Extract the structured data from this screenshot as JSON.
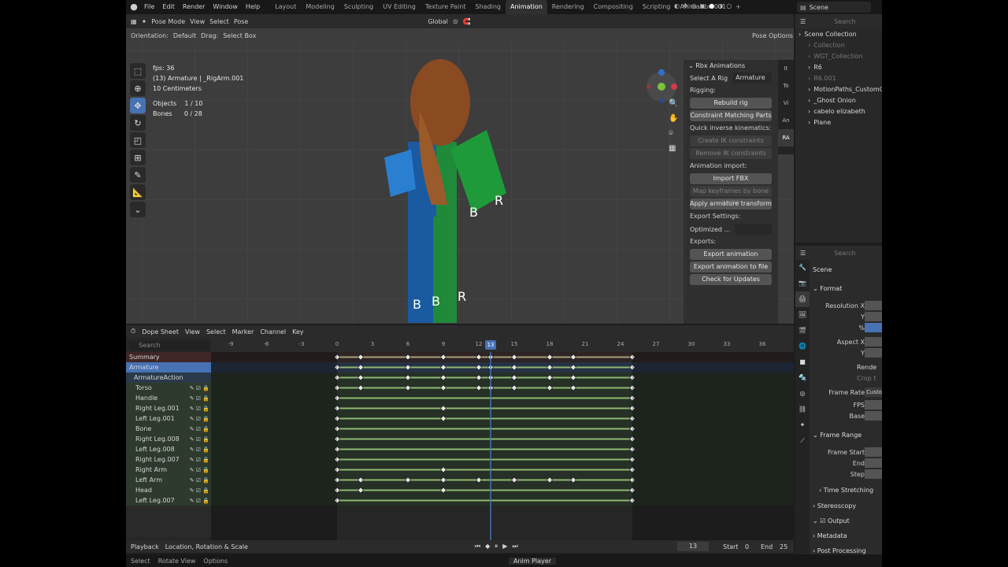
{
  "menu": {
    "items": [
      "File",
      "Edit",
      "Render",
      "Window",
      "Help"
    ]
  },
  "workspaces": [
    {
      "label": "Layout",
      "active": false
    },
    {
      "label": "Modeling",
      "active": false
    },
    {
      "label": "Sculpting",
      "active": false
    },
    {
      "label": "UV Editing",
      "active": false
    },
    {
      "label": "Texture Paint",
      "active": false
    },
    {
      "label": "Shading",
      "active": false
    },
    {
      "label": "Animation",
      "active": true
    },
    {
      "label": "Rendering",
      "active": false
    },
    {
      "label": "Compositing",
      "active": false
    },
    {
      "label": "Scripting",
      "active": false
    },
    {
      "label": "Animation.001",
      "active": false
    },
    {
      "label": "+",
      "active": false
    }
  ],
  "scene": {
    "name": "Scene"
  },
  "search_placeholder": "Search",
  "viewport": {
    "mode": "Pose Mode",
    "menu": [
      "View",
      "Select",
      "Pose"
    ],
    "transform": "Global",
    "orientation_label": "Orientation:",
    "orientation_value": "Default",
    "drag_label": "Drag:",
    "drag_value": "Select Box",
    "pose_options": "Pose Options",
    "info": {
      "fps": "fps: 36",
      "active": "(13) Armature | _RigArm.001",
      "units": "10 Centimeters",
      "objects_label": "Objects",
      "objects_value": "1 / 10",
      "bones_label": "Bones",
      "bones_value": "0 / 28"
    },
    "gizmo": {
      "x": "X",
      "y": "Y",
      "z": "Z"
    }
  },
  "rbx": {
    "title": "Rbx Animations",
    "select_rig_label": "Select A Rig",
    "select_rig_value": "Armature",
    "rigging_label": "Rigging:",
    "rebuild": "Rebuild rig",
    "constraint": "Constraint Matching Parts",
    "qik_label": "Quick inverse kinematics:",
    "create_ik": "Create IK constraints",
    "remove_ik": "Remove IK constraints",
    "import_label": "Animation import:",
    "import_fbx": "Import FBX",
    "map_keys": "Map keyframes by bone name",
    "apply_transform": "Apply armature transform",
    "export_settings_label": "Export Settings:",
    "optimized": "Optimized ...",
    "exports_label": "Exports:",
    "export_anim": "Export animation",
    "export_file": "Export animation to file",
    "check_updates": "Check for Updates",
    "tabs": [
      "It",
      "To",
      "Vi",
      "An",
      "RA"
    ]
  },
  "dope": {
    "mode": "Dope Sheet",
    "menu": [
      "View",
      "Select",
      "Marker",
      "Channel",
      "Key"
    ],
    "search_placeholder": "Search",
    "ruler": [
      -9,
      -6,
      -3,
      0,
      3,
      6,
      9,
      12,
      15,
      18,
      21,
      24,
      27,
      30,
      33,
      36
    ],
    "current_frame": 13,
    "channels": [
      {
        "name": "Summary",
        "type": "summary",
        "keys": [
          0,
          2,
          6,
          9,
          12,
          13,
          15,
          18,
          20,
          25
        ]
      },
      {
        "name": "Armature",
        "type": "object",
        "keys": [
          0,
          2,
          6,
          9,
          12,
          13,
          15,
          18,
          20,
          25
        ]
      },
      {
        "name": "ArmatureAction",
        "type": "action",
        "keys": [
          0,
          2,
          6,
          9,
          12,
          13,
          15,
          18,
          20,
          25
        ]
      },
      {
        "name": "Torso",
        "type": "bone",
        "keys": [
          0,
          2,
          6,
          9,
          12,
          13,
          15,
          18,
          20,
          25
        ]
      },
      {
        "name": "Handle",
        "type": "bone",
        "keys": [
          0,
          25
        ]
      },
      {
        "name": "Right Leg.001",
        "type": "bone",
        "keys": [
          0,
          9,
          25
        ]
      },
      {
        "name": "Left Leg.001",
        "type": "bone",
        "keys": [
          0,
          9,
          25
        ]
      },
      {
        "name": "Bone",
        "type": "bone",
        "keys": [
          0,
          25
        ]
      },
      {
        "name": "Right Leg.008",
        "type": "bone",
        "keys": [
          0,
          25
        ]
      },
      {
        "name": "Left Leg.008",
        "type": "bone",
        "keys": [
          0,
          25
        ]
      },
      {
        "name": "Right Leg.007",
        "type": "bone",
        "keys": [
          0,
          25
        ]
      },
      {
        "name": "Right Arm",
        "type": "bone",
        "keys": [
          0,
          9,
          25
        ]
      },
      {
        "name": "Left Arm",
        "type": "bone",
        "keys": [
          0,
          2,
          6,
          9,
          12,
          15,
          18,
          20,
          25
        ]
      },
      {
        "name": "Head",
        "type": "bone",
        "keys": [
          0,
          2,
          9,
          25
        ]
      },
      {
        "name": "Left Leg.007",
        "type": "bone",
        "keys": [
          0,
          25
        ]
      }
    ]
  },
  "playback": {
    "label": "Playback",
    "keying": "Location, Rotation & Scale",
    "current": "13",
    "start_label": "Start",
    "start": "0",
    "end_label": "End",
    "end": "25"
  },
  "status": {
    "select": "Select",
    "rotate": "Rotate View",
    "options": "Options",
    "anim_player": "Anim Player"
  },
  "outliner": {
    "items": [
      {
        "name": "Scene Collection",
        "indent": 0,
        "color": "#d6d6d6"
      },
      {
        "name": "Collection",
        "indent": 1,
        "color": "#777777"
      },
      {
        "name": "WGT_Collection",
        "indent": 1,
        "color": "#777777"
      },
      {
        "name": "R6",
        "indent": 1,
        "color": "#d6d6d6"
      },
      {
        "name": "R6.001",
        "indent": 1,
        "color": "#777777"
      },
      {
        "name": "MotionPaths_CustomOrigi",
        "indent": 1,
        "color": "#d6d6d6"
      },
      {
        "name": "_Ghost Onion",
        "indent": 1,
        "color": "#d6d6d6"
      },
      {
        "name": "cabelo elizabeth",
        "indent": 1,
        "color": "#d6d6d6"
      },
      {
        "name": "Plane",
        "indent": 1,
        "color": "#d6d6d6"
      }
    ]
  },
  "props": {
    "scene_label": "Scene",
    "format": "Format",
    "res_x": "Resolution X",
    "y": "Y",
    "pct": "%",
    "aspect_x": "Aspect X",
    "aspect_y": "Y",
    "render": "Rende",
    "crop": "Crop t",
    "frame_rate": "Frame Rate",
    "frame_rate_value": "Custom",
    "fps": "FPS",
    "base": "Base",
    "frame_range": "Frame Range",
    "frame_start": "Frame Start",
    "end": "End",
    "step": "Step",
    "time_stretching": "Time Stretching",
    "stereoscopy": "Stereoscopy",
    "output": "Output",
    "metadata": "Metadata",
    "post": "Post Processing"
  },
  "colors": {
    "accent": "#4772b3",
    "key": "#e6e6e6",
    "row_green": "#2d3a2d",
    "summary": "#3f2525"
  }
}
